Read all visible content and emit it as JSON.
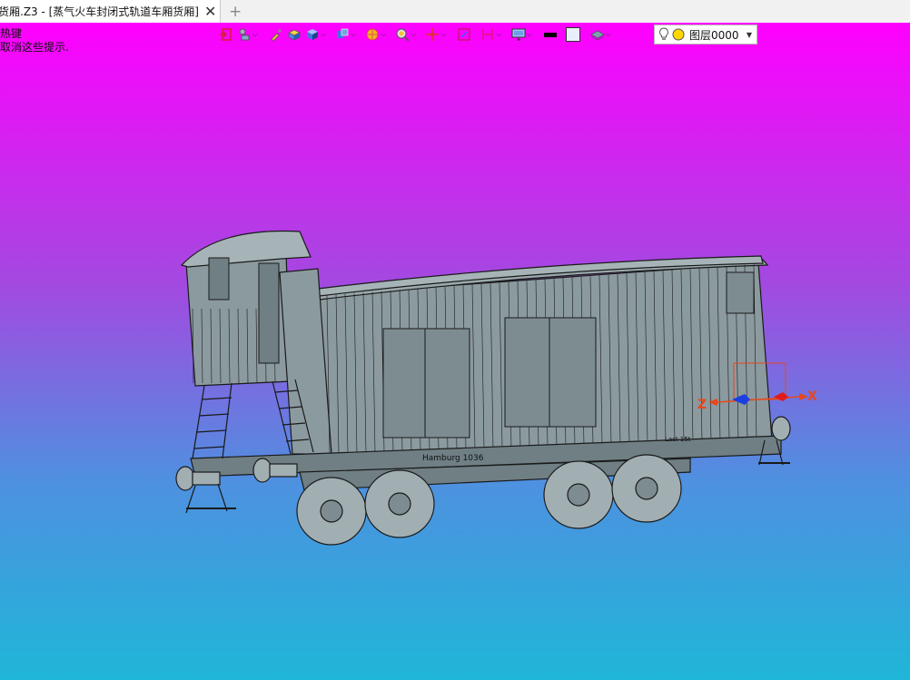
{
  "tab": {
    "title": "货厢.Z3 - [蒸气火车封闭式轨道车厢货厢]",
    "close_glyph": "✕",
    "add_glyph": "+"
  },
  "hint": {
    "line1": "热键",
    "line2": "取消这些提示."
  },
  "toolbar": {
    "icons": [
      "exit-icon",
      "render-icon",
      "brush-icon",
      "box-icon",
      "cube-icon",
      "view-cube-icon",
      "shading-icon",
      "zoom-icon",
      "move-icon",
      "select-icon",
      "measure-icon",
      "display-icon",
      "line-color-icon",
      "fill-color-icon",
      "layer-stack-icon"
    ],
    "layer": {
      "name": "图层0000",
      "bulb_color": "#ffd800"
    }
  },
  "colors": {
    "bg_top": "#ff00ff",
    "bg_bottom": "#1fb6d8",
    "model_fill": "#8b9a9f",
    "model_line": "#1a1a1a",
    "axis_x": "#e8471b",
    "axis_z": "#e8471b"
  },
  "axes": {
    "x": "X",
    "z": "Z"
  },
  "model_labels": {
    "side_text": "Hamburg 1036",
    "small_text": "Last 15t"
  }
}
